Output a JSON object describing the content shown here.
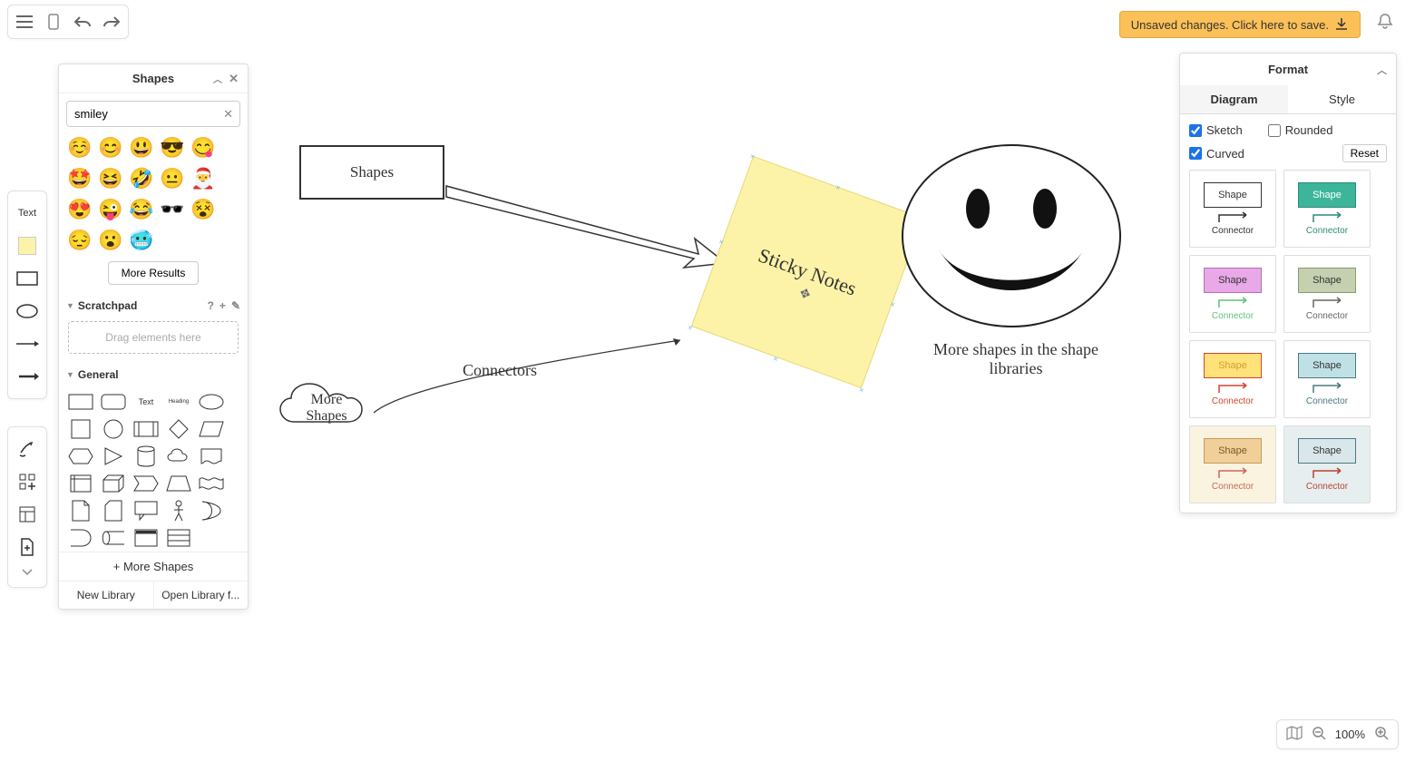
{
  "toolbar": {
    "unsaved_label": "Unsaved changes. Click here to save."
  },
  "slim": {
    "text_label": "Text"
  },
  "shapes_panel": {
    "title": "Shapes",
    "search_value": "smiley",
    "more_results": "More Results",
    "scratchpad_label": "Scratchpad",
    "scratch_drop": "Drag elements here",
    "general_label": "General",
    "more_shapes": "+ More Shapes",
    "new_library": "New Library",
    "open_library": "Open Library f...",
    "emojis": [
      "☺️",
      "😊",
      "😃",
      "😎",
      "😋",
      "🤩",
      "😆",
      "🤣",
      "😐",
      "🎅",
      "😍",
      "😜",
      "😂",
      "🕶️",
      "😵",
      "😔",
      "😮",
      "🥶"
    ],
    "general_text_label": "Text",
    "general_heading_label": "Heading"
  },
  "canvas": {
    "shapes_box": "Shapes",
    "sticky_text": "Sticky Notes",
    "connectors_label": "Connectors",
    "more_shapes_cloud": "More\nShapes",
    "smiley_caption": "More shapes in the shape libraries"
  },
  "format": {
    "title": "Format",
    "tab_diagram": "Diagram",
    "tab_style": "Style",
    "sketch": "Sketch",
    "rounded": "Rounded",
    "curved": "Curved",
    "reset": "Reset",
    "sketch_checked": true,
    "rounded_checked": false,
    "curved_checked": true,
    "styles": [
      {
        "bg": "#ffffff",
        "shape_fill": "#ffffff",
        "shape_stroke": "#333",
        "conn": "#333",
        "label": "Shape",
        "conn_label": "Connector",
        "text": "#333"
      },
      {
        "bg": "#ffffff",
        "shape_fill": "#3cb59a",
        "shape_stroke": "#2a8c77",
        "conn": "#2a8c77",
        "label": "Shape",
        "conn_label": "Connector",
        "text": "#fff"
      },
      {
        "bg": "#ffffff",
        "shape_fill": "#e9a8e8",
        "shape_stroke": "#b56fb4",
        "conn": "#5ec27a",
        "label": "Shape",
        "conn_label": "Connector",
        "text": "#333"
      },
      {
        "bg": "#ffffff",
        "shape_fill": "#c4d0b0",
        "shape_stroke": "#8a9a72",
        "conn": "#666",
        "label": "Shape",
        "conn_label": "Connector",
        "text": "#333"
      },
      {
        "bg": "#ffffff",
        "shape_fill": "#ffe27a",
        "shape_stroke": "#d6442f",
        "conn": "#d6442f",
        "label": "Shape",
        "conn_label": "Connector",
        "text": "#d6a22f"
      },
      {
        "bg": "#ffffff",
        "shape_fill": "#bfe1e6",
        "shape_stroke": "#4a7a82",
        "conn": "#4a7a82",
        "label": "Shape",
        "conn_label": "Connector",
        "text": "#333"
      },
      {
        "bg": "#faf3e0",
        "shape_fill": "#f0cf9a",
        "shape_stroke": "#c99a58",
        "conn": "#c96a58",
        "label": "Shape",
        "conn_label": "Connector",
        "text": "#7a5a2a"
      },
      {
        "bg": "#e7eef0",
        "shape_fill": "#d9e6ea",
        "shape_stroke": "#4a7a82",
        "conn": "#b5442f",
        "label": "Shape",
        "conn_label": "Connector",
        "text": "#333"
      }
    ]
  },
  "zoom": {
    "level": "100%"
  }
}
